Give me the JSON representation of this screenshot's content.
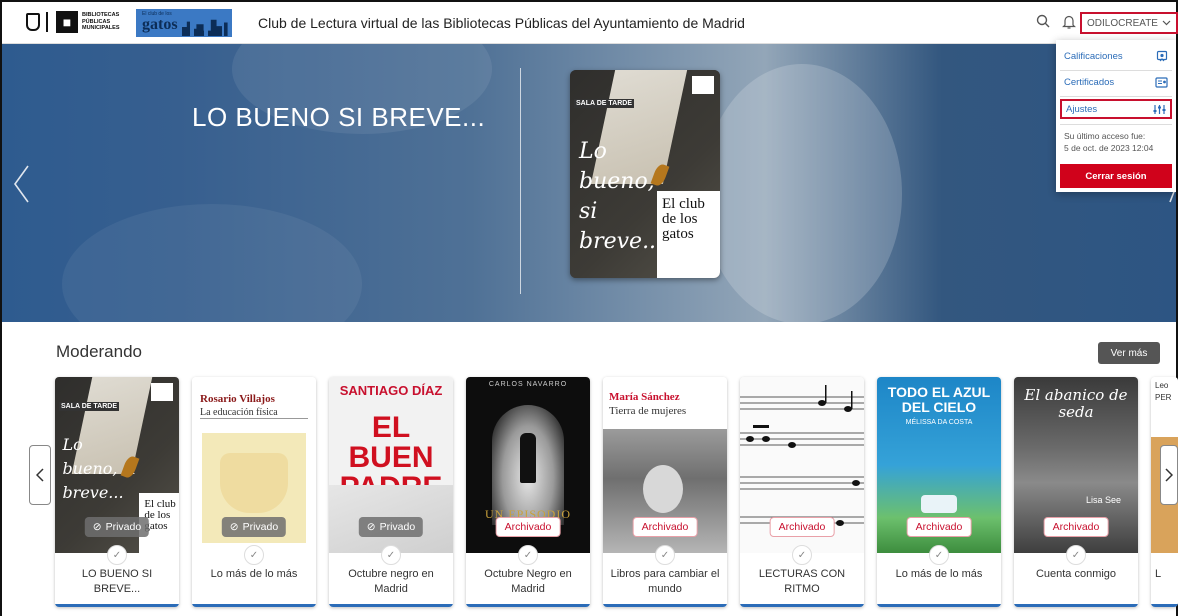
{
  "header": {
    "logo_bib_text": "BIBLIOTECAS PÚBLICAS MUNICIPALES",
    "logo_gatos_small": "El club de los",
    "logo_gatos_big": "gatos",
    "site_title": "Club de Lectura virtual de las Bibliotecas Públicas del Ayuntamiento de Madrid",
    "user_label": "ODILOCREATE"
  },
  "user_menu": {
    "items": [
      {
        "label": "Calificaciones",
        "icon": "ratings-icon"
      },
      {
        "label": "Certificados",
        "icon": "certificate-icon"
      },
      {
        "label": "Ajustes",
        "icon": "settings-sliders-icon"
      }
    ],
    "last_access_label": "Su último acceso fue:",
    "last_access_value": "5 de oct. de 2023 12:04",
    "logout_label": "Cerrar sesión"
  },
  "hero": {
    "title": "LO BUENO SI BREVE...",
    "book": {
      "tag": "SALA DE TARDE",
      "script_title": "Lo bueno, si breve...",
      "club_text": "El club de los gatos"
    }
  },
  "section": {
    "title": "Moderando",
    "see_more": "Ver más"
  },
  "cards": [
    {
      "name": "LO BUENO SI BREVE...",
      "badge": "Privado",
      "badge_type": "priv"
    },
    {
      "name": "Lo más de lo más",
      "badge": "Privado",
      "badge_type": "priv",
      "cover_author": "Rosario Villajos",
      "cover_title": "La educación física"
    },
    {
      "name": "Octubre negro en Madrid",
      "badge": "Privado",
      "badge_type": "priv",
      "cover_author": "SANTIAGO DÍAZ",
      "cover_title": "EL BUEN PADRE"
    },
    {
      "name": "Octubre Negro en Madrid",
      "badge": "Archivado",
      "badge_type": "arch",
      "cover_author": "CARLOS NAVARRO",
      "cover_title": "UN EPISODIO"
    },
    {
      "name": "Libros para cambiar el mundo",
      "badge": "Archivado",
      "badge_type": "arch",
      "cover_author": "María Sánchez",
      "cover_title": "Tierra de mujeres"
    },
    {
      "name": "LECTURAS CON RITMO",
      "badge": "Archivado",
      "badge_type": "arch"
    },
    {
      "name": "Lo más de lo más",
      "badge": "Archivado",
      "badge_type": "arch",
      "cover_title": "TODO EL AZUL DEL CIELO",
      "cover_author": "MÉLISSA DA COSTA"
    },
    {
      "name": "Cuenta conmigo",
      "badge": "Archivado",
      "badge_type": "arch",
      "cover_title": "El abanico de seda",
      "cover_author": "Lisa See"
    },
    {
      "name": "L",
      "cover_author": "Leo",
      "cover_title": "PER"
    }
  ],
  "colors": {
    "accent": "#c8102e",
    "link": "#2b6cb8",
    "card_bar": "#2b6cb8"
  }
}
